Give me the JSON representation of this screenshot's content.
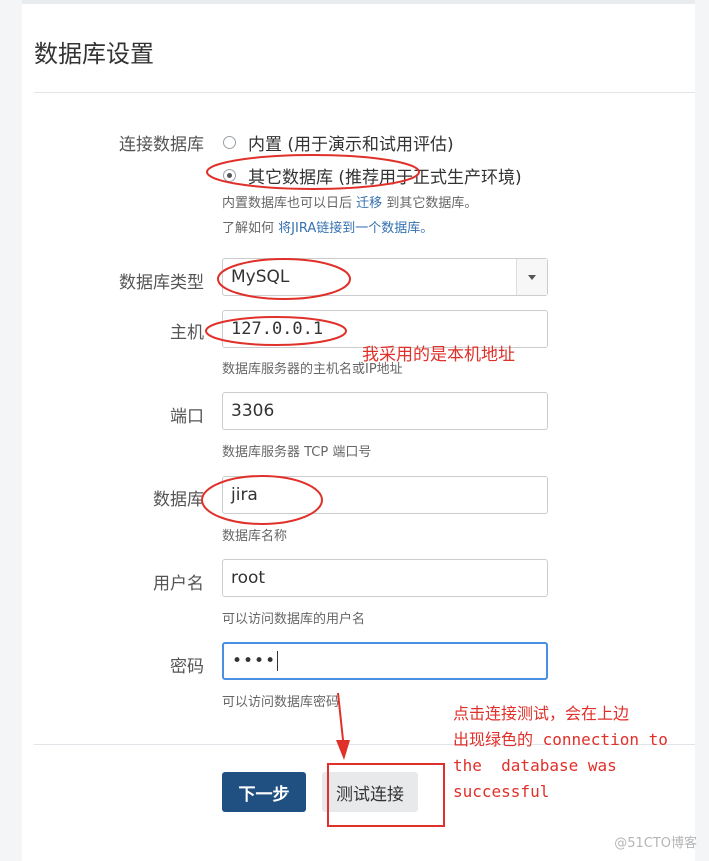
{
  "dialog": {
    "title": "数据库设置"
  },
  "connection": {
    "label": "连接数据库",
    "option_builtin": "内置 (用于演示和试用评估)",
    "option_other": "其它数据库 (推荐用于正式生产环境)",
    "hint_line1_prefix": "内置数据库也可以日后",
    "hint_line1_link": "迁移",
    "hint_line1_suffix": "到其它数据库。",
    "hint_line2_prefix": "了解如何",
    "hint_line2_link": "将JIRA链接到一个数据库。"
  },
  "db_type": {
    "label": "数据库类型",
    "value": "MySQL"
  },
  "host": {
    "label": "主机",
    "value": "127.0.0.1",
    "hint": "数据库服务器的主机名或IP地址"
  },
  "port": {
    "label": "端口",
    "value": "3306",
    "hint": "数据库服务器 TCP 端口号"
  },
  "database": {
    "label": "数据库",
    "value": "jira",
    "hint": "数据库名称"
  },
  "username": {
    "label": "用户名",
    "value": "root",
    "hint": "可以访问数据库的用户名"
  },
  "password": {
    "label": "密码",
    "value": "••••",
    "hint": "可以访问数据库密码"
  },
  "buttons": {
    "next": "下一步",
    "test": "测试连接"
  },
  "annotations": {
    "host_note": "我采用的是本机地址",
    "test_note_line1": "点击连接测试，会在上边",
    "test_note_line2": "出现绿色的 connection to",
    "test_note_line3": "the  database was",
    "test_note_line4": "successful"
  },
  "watermark": "@51CTO博客",
  "colors": {
    "primary_button": "#205081",
    "link": "#3572b0",
    "annotation_red": "#e0302a",
    "focus_border": "#4a90e2"
  }
}
